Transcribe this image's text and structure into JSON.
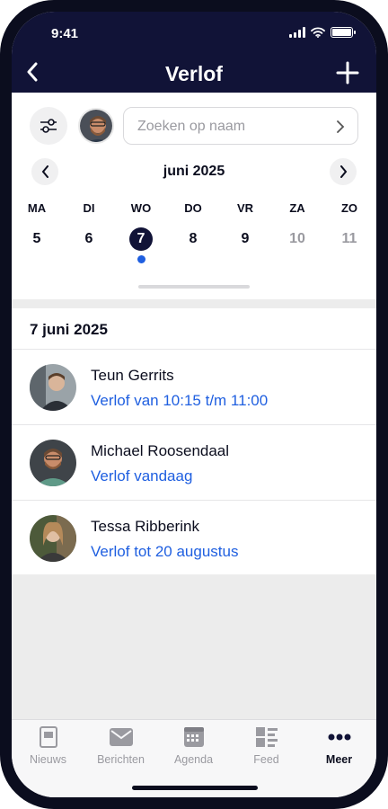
{
  "status_bar": {
    "time": "9:41"
  },
  "header": {
    "title": "Verlof"
  },
  "search": {
    "placeholder": "Zoeken op naam"
  },
  "calendar": {
    "month": "juni 2025",
    "days": [
      {
        "dow": "MA",
        "num": "5"
      },
      {
        "dow": "DI",
        "num": "6"
      },
      {
        "dow": "WO",
        "num": "7"
      },
      {
        "dow": "DO",
        "num": "8"
      },
      {
        "dow": "VR",
        "num": "9"
      },
      {
        "dow": "ZA",
        "num": "10"
      },
      {
        "dow": "ZO",
        "num": "11"
      }
    ]
  },
  "list": {
    "date_heading": "7 juni 2025",
    "items": [
      {
        "name": "Teun Gerrits",
        "detail": "Verlof van 10:15 t/m 11:00"
      },
      {
        "name": "Michael Roosendaal",
        "detail": "Verlof vandaag"
      },
      {
        "name": "Tessa Ribberink",
        "detail": "Verlof tot 20 augustus"
      }
    ]
  },
  "tabs": [
    {
      "label": "Nieuws",
      "icon": "news-icon"
    },
    {
      "label": "Berichten",
      "icon": "envelope-icon"
    },
    {
      "label": "Agenda",
      "icon": "calendar-icon"
    },
    {
      "label": "Feed",
      "icon": "feed-icon"
    },
    {
      "label": "Meer",
      "icon": "more-icon"
    }
  ],
  "colors": {
    "header_bg": "#111337",
    "accent": "#1f5fe0",
    "text": "#0b0d1e"
  }
}
